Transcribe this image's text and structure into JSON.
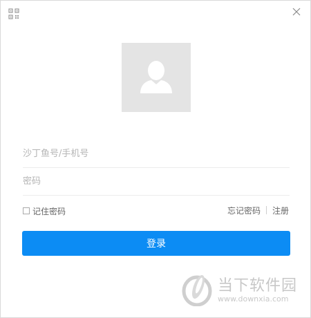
{
  "header": {
    "qr_icon": "qr-code-icon",
    "close_icon": "close-icon"
  },
  "avatar": {
    "icon": "user-silhouette-icon",
    "background": "#e4e4e4"
  },
  "form": {
    "account_placeholder": "沙丁鱼号/手机号",
    "account_value": "",
    "password_placeholder": "密码",
    "password_value": "",
    "remember_label": "记住密码",
    "remember_checked": false,
    "forgot_label": "忘记密码",
    "register_label": "注册",
    "login_label": "登录"
  },
  "watermark": {
    "title": "当下软件园",
    "url": "www.downxia.com"
  },
  "colors": {
    "accent": "#0c8cf4",
    "border": "#d9d9d9"
  }
}
